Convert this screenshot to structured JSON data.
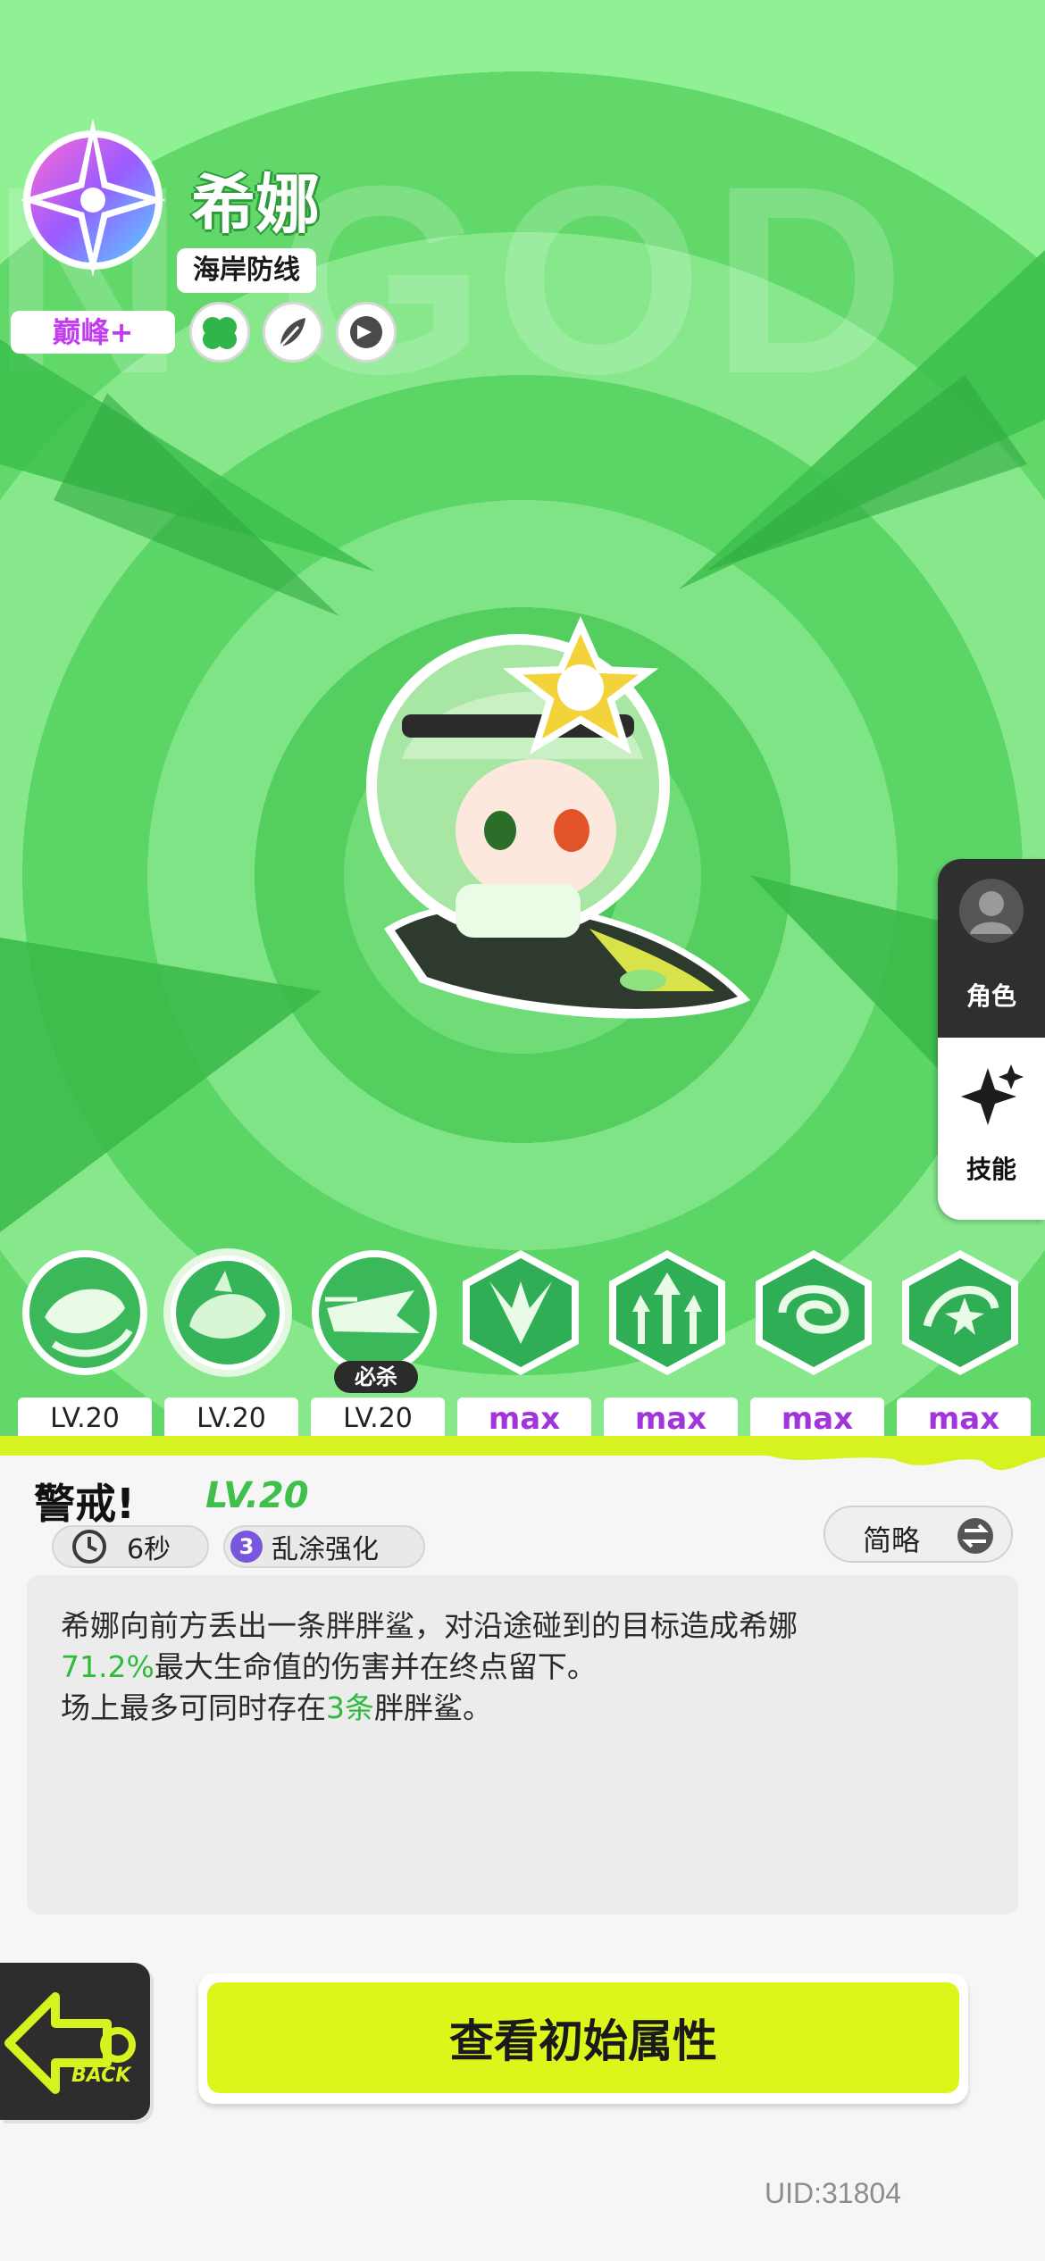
{
  "character": {
    "name": "希娜",
    "subtitle": "海岸防线",
    "rank": "巅峰+",
    "traits": [
      "clover-icon",
      "feather-icon",
      "claw-icon"
    ]
  },
  "side_tabs": [
    {
      "label": "角色",
      "icon": "person-icon",
      "active": false
    },
    {
      "label": "技能",
      "icon": "sparkle-icon",
      "active": true
    }
  ],
  "skills": [
    {
      "icon": "fish-swirl-icon",
      "level": "LV.20"
    },
    {
      "icon": "shark-icon",
      "level": "LV.20",
      "selected": true
    },
    {
      "icon": "shark-dash-icon",
      "level": "LV.20",
      "tag": "必杀"
    },
    {
      "icon": "slash-icon",
      "level": "max"
    },
    {
      "icon": "triple-arrow-icon",
      "level": "max"
    },
    {
      "icon": "vortex-icon",
      "level": "max"
    },
    {
      "icon": "swirl-star-icon",
      "level": "max"
    }
  ],
  "detail": {
    "title": "警戒!",
    "level": "LV.20",
    "cooldown": "6秒",
    "upgrade_num": "3",
    "upgrade_label": "乱涂强化",
    "brief_label": "简略",
    "desc": {
      "line1": "希娜向前方丢出一条胖胖鲨，对沿途碰到的目标造成希娜",
      "line2_hl": "71.2%",
      "line2": "最大生命值的伤害并在终点留下。",
      "line3_a": "场上最多可同时存在",
      "line3_hl": "3条",
      "line3_b": "胖胖鲨。"
    }
  },
  "buttons": {
    "back_label": "BACK",
    "view_attributes": "查看初始属性"
  },
  "uid": "UID:31804",
  "colors": {
    "accent_green": "#3fc04b",
    "button_yellow": "#dcf51b",
    "max_purple": "#a235d9",
    "rank_purple": "#c23cf0"
  }
}
